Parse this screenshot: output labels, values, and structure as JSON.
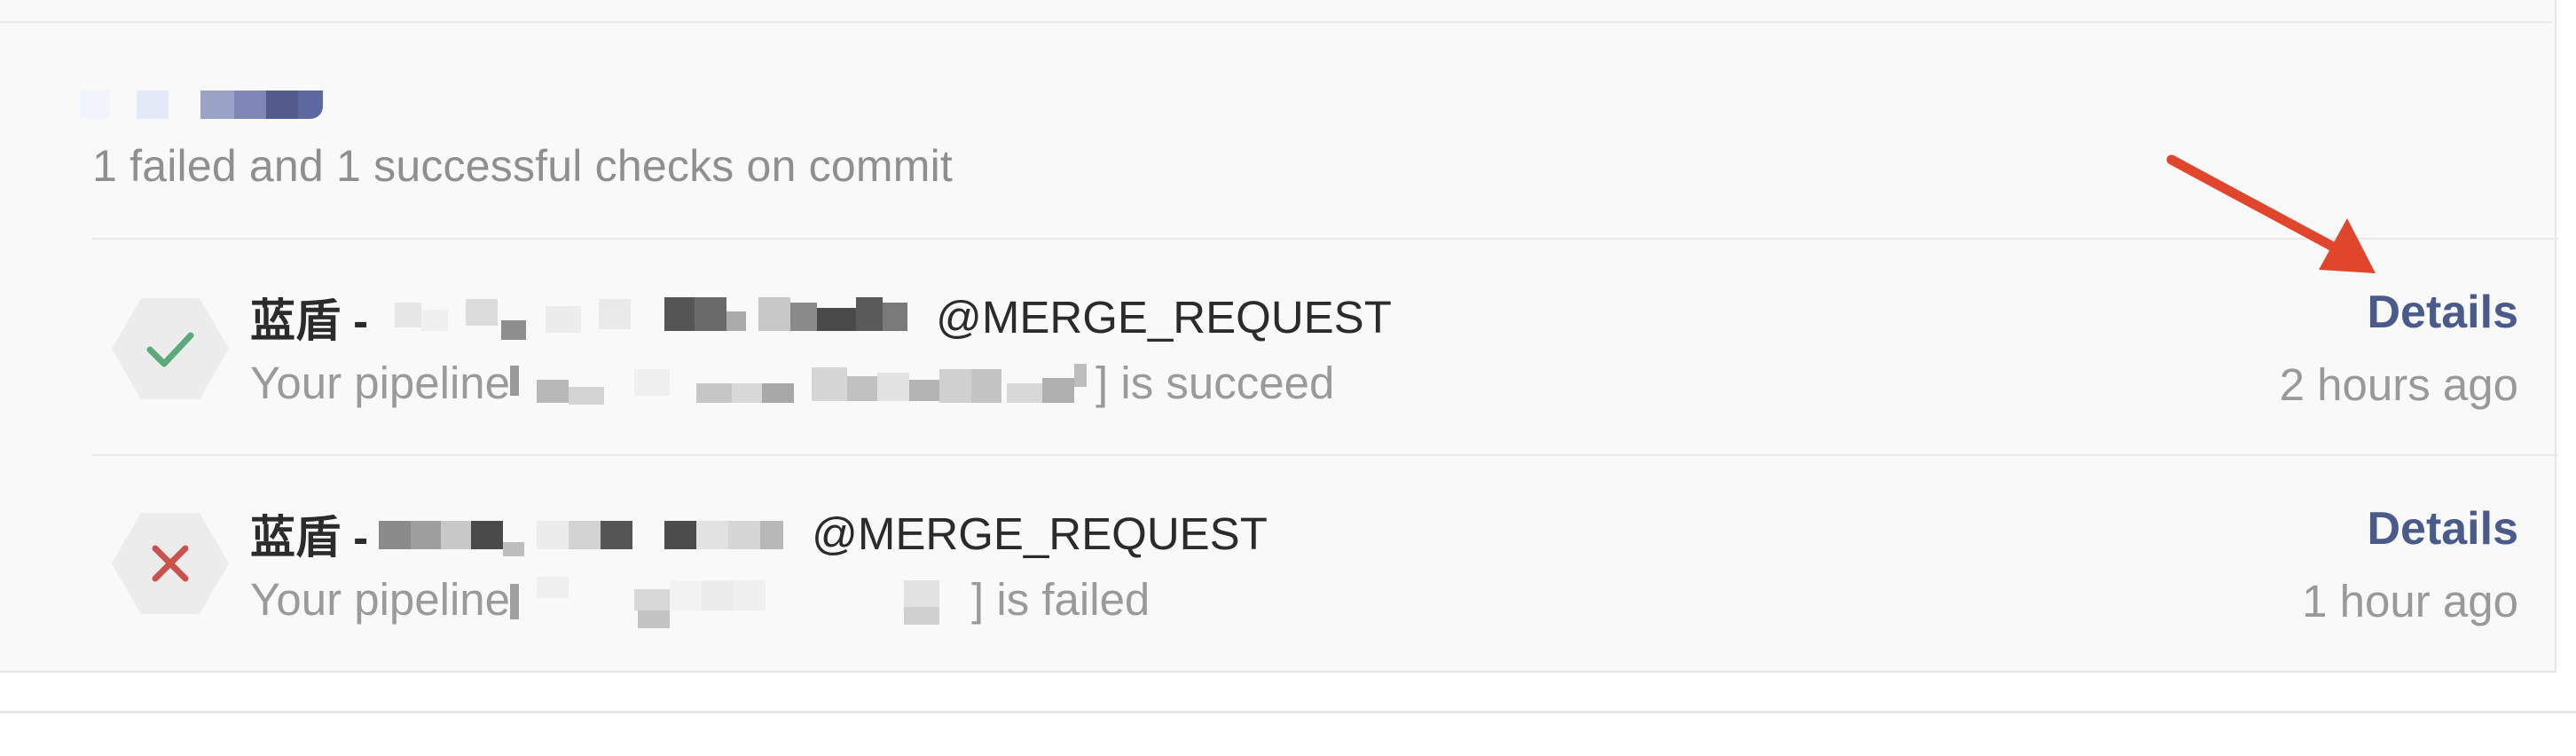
{
  "summary_text": "1 failed and 1 successful checks on commit",
  "checks": [
    {
      "status": "success",
      "status_icon": "check-icon",
      "status_color": "#5aaa7a",
      "title_prefix": "蓝盾 - ",
      "title_suffix": "@MERGE_REQUEST",
      "pipeline_prefix": "Your pipeline ",
      "pipeline_suffix": "] is succeed",
      "details_label": "Details",
      "time_ago": "2 hours ago"
    },
    {
      "status": "failed",
      "status_icon": "cross-icon",
      "status_color": "#c9524d",
      "title_prefix": "蓝盾 - ",
      "title_suffix": "@MERGE_REQUEST",
      "pipeline_prefix": "Your pipeline ",
      "pipeline_suffix": " ] is failed",
      "details_label": "Details",
      "time_ago": "1 hour ago"
    }
  ],
  "colors": {
    "link": "#4a5a8a",
    "annotation_arrow": "#e0462b",
    "panel_bg": "#f9f9f9"
  }
}
